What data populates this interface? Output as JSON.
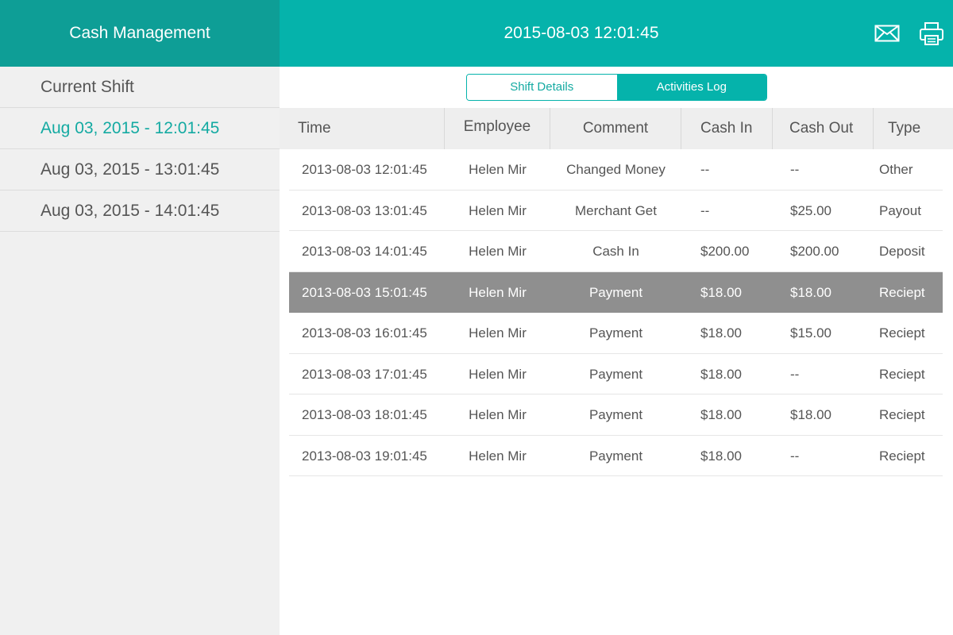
{
  "header": {
    "title": "Cash Management",
    "datetime": "2015-08-03 12:01:45",
    "icons": [
      "mail-icon",
      "print-icon"
    ]
  },
  "sidebar": {
    "items": [
      {
        "label": "Current Shift",
        "active": false
      },
      {
        "label": "Aug 03, 2015 - 12:01:45",
        "active": true
      },
      {
        "label": "Aug 03, 2015 - 13:01:45",
        "active": false
      },
      {
        "label": "Aug 03, 2015 - 14:01:45",
        "active": false
      }
    ]
  },
  "tabs": [
    {
      "label": "Shift Details",
      "selected": false
    },
    {
      "label": "Activities Log",
      "selected": true
    }
  ],
  "table": {
    "columns": [
      "Time",
      "Employee",
      "Comment",
      "Cash In",
      "Cash Out",
      "Type"
    ],
    "rows": [
      {
        "time": "2013-08-03 12:01:45",
        "employee": "Helen Mir",
        "comment": "Changed Money",
        "cash_in": "--",
        "cash_out": "--",
        "type": "Other",
        "selected": false
      },
      {
        "time": "2013-08-03 13:01:45",
        "employee": "Helen Mir",
        "comment": "Merchant Get",
        "cash_in": "--",
        "cash_out": "$25.00",
        "type": "Payout",
        "selected": false
      },
      {
        "time": "2013-08-03 14:01:45",
        "employee": "Helen Mir",
        "comment": "Cash In",
        "cash_in": "$200.00",
        "cash_out": "$200.00",
        "type": "Deposit",
        "selected": false
      },
      {
        "time": "2013-08-03 15:01:45",
        "employee": "Helen Mir",
        "comment": "Payment",
        "cash_in": "$18.00",
        "cash_out": "$18.00",
        "type": "Reciept",
        "selected": true
      },
      {
        "time": "2013-08-03 16:01:45",
        "employee": "Helen Mir",
        "comment": "Payment",
        "cash_in": "$18.00",
        "cash_out": "$15.00",
        "type": "Reciept",
        "selected": false
      },
      {
        "time": "2013-08-03 17:01:45",
        "employee": "Helen Mir",
        "comment": "Payment",
        "cash_in": "$18.00",
        "cash_out": "--",
        "type": "Reciept",
        "selected": false
      },
      {
        "time": "2013-08-03 18:01:45",
        "employee": "Helen Mir",
        "comment": "Payment",
        "cash_in": "$18.00",
        "cash_out": "$18.00",
        "type": "Reciept",
        "selected": false
      },
      {
        "time": "2013-08-03 19:01:45",
        "employee": "Helen Mir",
        "comment": "Payment",
        "cash_in": "$18.00",
        "cash_out": "--",
        "type": "Reciept",
        "selected": false
      }
    ]
  },
  "colors": {
    "header_left": "#0e9e96",
    "header_right": "#05b3ab",
    "accent": "#14aaa2",
    "selected_row": "#8f8f8f"
  }
}
